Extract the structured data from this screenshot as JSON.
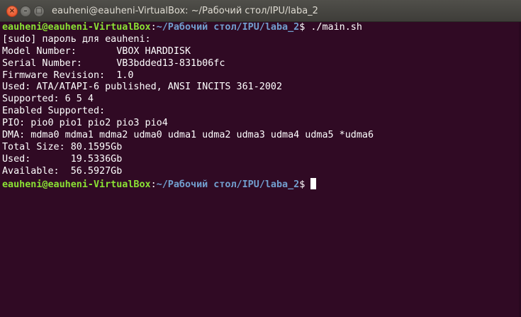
{
  "window": {
    "title": "eauheni@eauheni-VirtualBox: ~/Рабочий стол/IPU/laba_2",
    "close_symbol": "×",
    "minimize_symbol": "–",
    "maximize_symbol": "□"
  },
  "terminal": {
    "prompt": {
      "user_host": "eauheni@eauheni-VirtualBox",
      "colon": ":",
      "path": "~/Рабочий стол/IPU/laba_2",
      "dollar": "$"
    },
    "command": " ./main.sh",
    "output": [
      "[sudo] пароль для eauheni:",
      "Model Number:       VBOX HARDDISK",
      "Serial Number:      VB3bdded13-831b06fc",
      "Firmware Revision:  1.0",
      "Used: ATA/ATAPI-6 published, ANSI INCITS 361-2002",
      "Supported: 6 5 4",
      "Enabled Supported:",
      "PIO: pio0 pio1 pio2 pio3 pio4",
      "DMA: mdma0 mdma1 mdma2 udma0 udma1 udma2 udma3 udma4 udma5 *udma6",
      "Total Size: 80.1595Gb",
      "Used:       19.5336Gb",
      "Available:  56.5927Gb"
    ]
  },
  "colors": {
    "terminal_background": "#300a24",
    "prompt_user": "#8ae234",
    "prompt_path": "#729fcf",
    "text": "#ffffff"
  }
}
